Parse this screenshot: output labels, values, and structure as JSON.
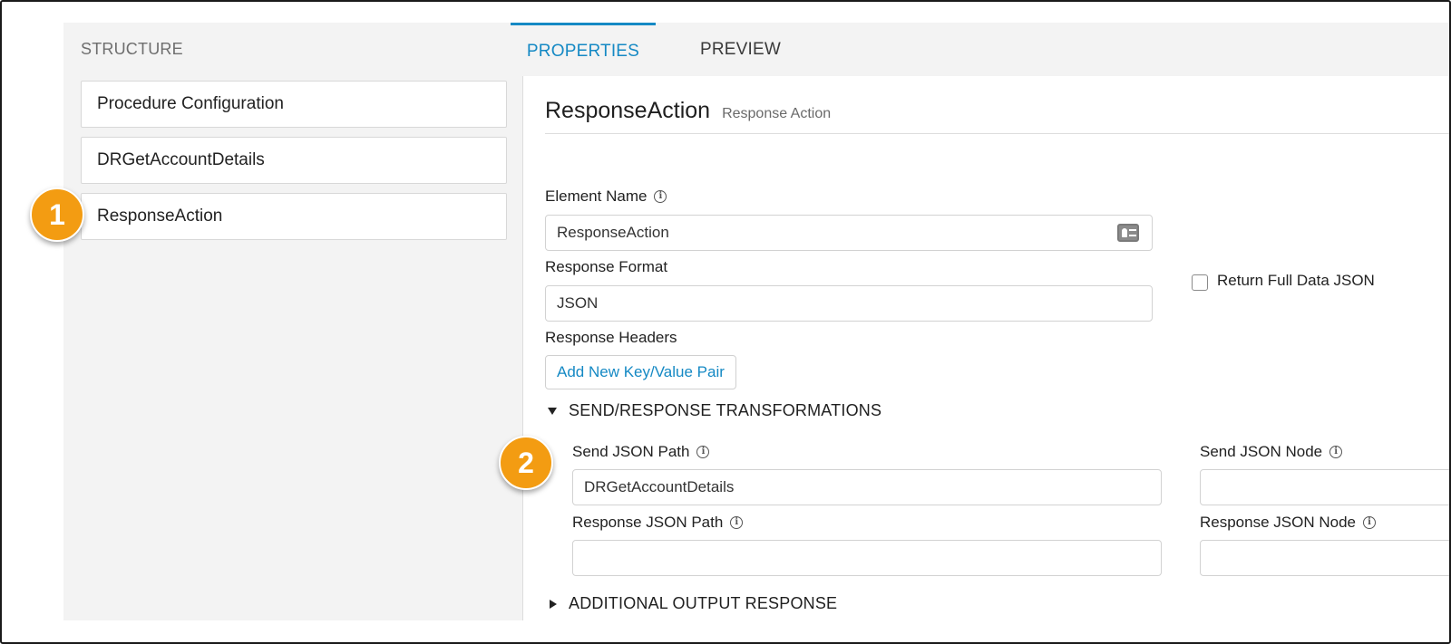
{
  "structure": {
    "header": "STRUCTURE",
    "items": [
      {
        "label": "Procedure Configuration"
      },
      {
        "label": "DRGetAccountDetails"
      },
      {
        "label": "ResponseAction"
      }
    ]
  },
  "tabs": [
    {
      "label": "PROPERTIES",
      "active": true
    },
    {
      "label": "PREVIEW",
      "active": false
    }
  ],
  "properties": {
    "title": "ResponseAction",
    "subtitle": "Response Action",
    "element_name_label": "Element Name",
    "element_name_value": "ResponseAction",
    "response_format_label": "Response Format",
    "response_format_value": "JSON",
    "return_full_label": "Return Full Data JSON",
    "response_headers_label": "Response Headers",
    "add_pair_button": "Add New Key/Value Pair",
    "send_response_section": "SEND/RESPONSE TRANSFORMATIONS",
    "send_json_path_label": "Send JSON Path",
    "send_json_path_value": "DRGetAccountDetails",
    "send_json_node_label": "Send JSON Node",
    "response_json_path_label": "Response JSON Path",
    "response_json_node_label": "Response JSON Node",
    "additional_section": "ADDITIONAL OUTPUT RESPONSE"
  },
  "callouts": [
    "1",
    "2"
  ],
  "icons": {
    "info": "info-icon",
    "contact_card": "contact-card-icon"
  },
  "colors": {
    "accent": "#1589c4",
    "callout": "#f39c12"
  }
}
